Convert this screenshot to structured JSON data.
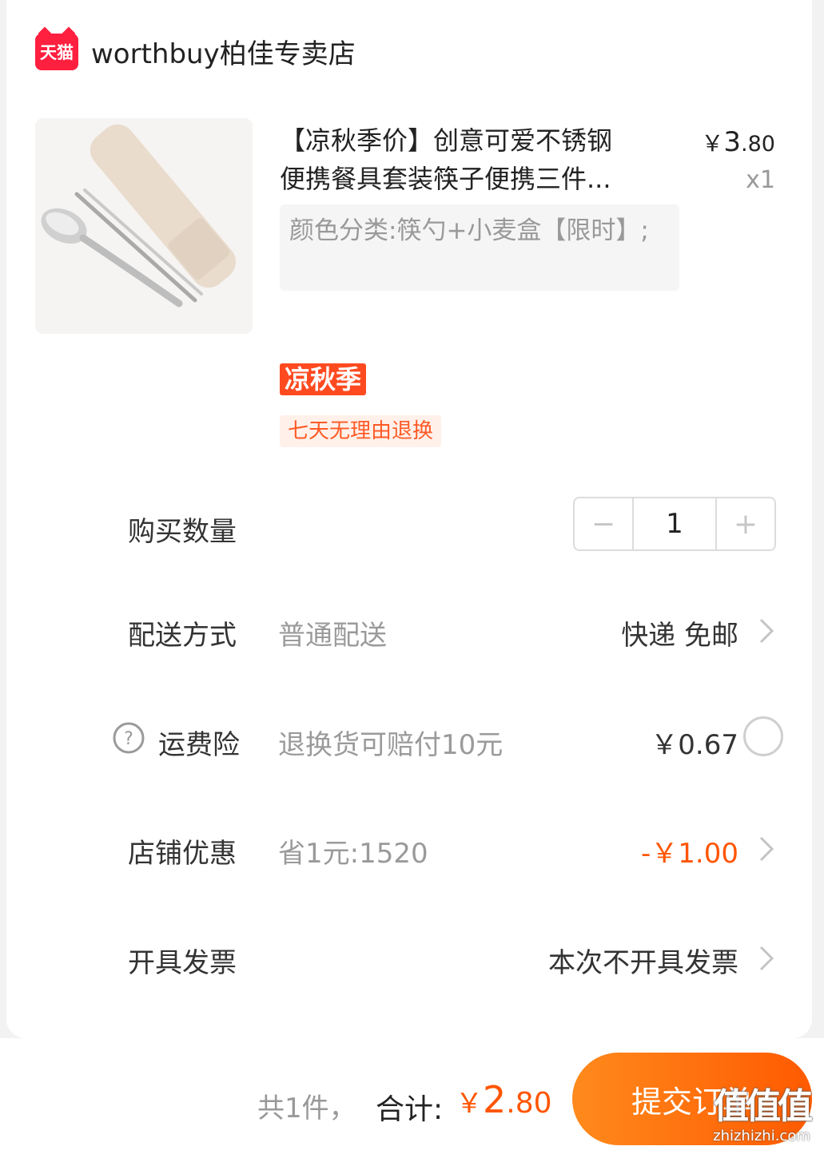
{
  "store": {
    "badge": "天猫",
    "name": "worthbuy柏佳专卖店"
  },
  "product": {
    "title_line1": "【凉秋季价】创意可爱不锈钢",
    "title_line2": "便携餐具套装筷子便携三件...",
    "price_yen": "￥",
    "price_int": "3",
    "price_dec": ".80",
    "quantity_label": "x1",
    "sku": "颜色分类:筷勺+小麦盒【限时】;",
    "promo_tag": "凉秋季",
    "service_tag": "七天无理由退换"
  },
  "order": {
    "quantity": {
      "label": "购买数量",
      "value": "1",
      "minus": "−",
      "plus": "+"
    },
    "delivery": {
      "label": "配送方式",
      "sub": "普通配送",
      "value": "快递 免邮"
    },
    "insurance": {
      "label": "运费险",
      "sub": "退换货可赔付10元",
      "value": "￥0.67"
    },
    "discount": {
      "label": "店铺优惠",
      "sub": "省1元:1520",
      "value": "-￥1.00"
    },
    "invoice": {
      "label": "开具发票",
      "value": "本次不开具发票"
    }
  },
  "footer": {
    "count_text": "共1件，",
    "total_label": "合计:",
    "total_yen": "￥",
    "total_int": "2",
    "total_dec": ".80",
    "submit_label": "提交订单"
  },
  "watermark": {
    "logo": "值值值",
    "url": "zhizhizhi.com"
  },
  "colors": {
    "accent": "#ff5500",
    "tmall": "#ff1f3f",
    "promo": "#ff4a20"
  }
}
